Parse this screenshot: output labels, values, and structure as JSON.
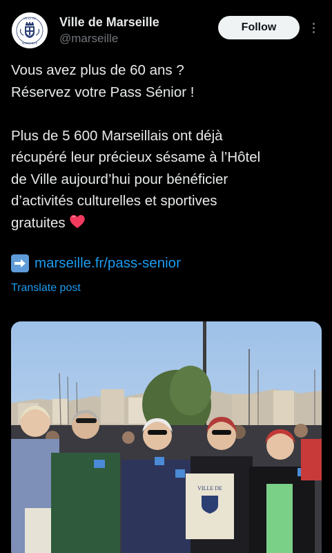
{
  "author": {
    "name": "Ville de Marseille",
    "handle": "@marseille",
    "avatar_icon": "marseille-coat-of-arms-icon",
    "avatar_text": "VILLE DE MARSEILLE"
  },
  "actions": {
    "follow_label": "Follow",
    "more_icon": "more-vertical-icon"
  },
  "post": {
    "line1": "Vous avez plus de 60 ans ?",
    "line2": "Réservez votre Pass Sénior !",
    "para_lines": [
      "Plus de 5 600 Marseillais ont déjà",
      "récupéré leur précieux sésame à l’Hôtel",
      "de Ville aujourd’hui pour bénéficier",
      "d’activités culturelles et sportives",
      "gratuites"
    ],
    "heart_icon": "red-heart-emoji",
    "arrow_icon": "right-arrow-emoji",
    "link_text": "marseille.fr/pass-senior",
    "translate_label": "Translate post"
  },
  "media": {
    "tote_text": "VILLE DE",
    "colors": {
      "sky": "#8fb6e3",
      "link": "#1d9bf0"
    }
  }
}
